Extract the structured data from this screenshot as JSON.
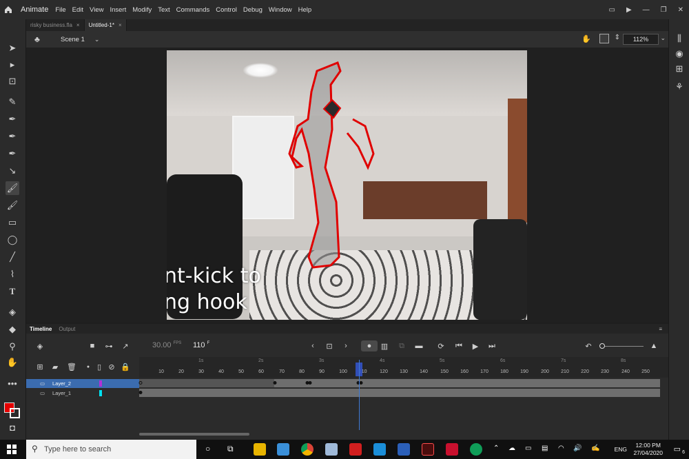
{
  "app": {
    "name": "Animate",
    "menu": [
      "File",
      "Edit",
      "View",
      "Insert",
      "Modify",
      "Text",
      "Commands",
      "Control",
      "Debug",
      "Window",
      "Help"
    ]
  },
  "tabs": [
    {
      "label": "risky business.fla",
      "active": false
    },
    {
      "label": "Untitled-1*",
      "active": true
    }
  ],
  "scene": {
    "label": "Scene 1"
  },
  "zoom": {
    "value": "112%"
  },
  "stage": {
    "caption_line1": "nt-kick to",
    "caption_line2": "ng hook"
  },
  "timeline": {
    "tab_timeline": "Timeline",
    "tab_output": "Output",
    "fps_value": "30.00",
    "fps_unit": "FPS",
    "current_frame": "110",
    "frame_unit": "F",
    "seconds": [
      "1s",
      "2s",
      "3s",
      "4s",
      "5s",
      "6s",
      "7s",
      "8s"
    ],
    "frame_ticks": [
      "10",
      "20",
      "30",
      "40",
      "50",
      "60",
      "70",
      "80",
      "90",
      "100",
      "110",
      "120",
      "130",
      "140",
      "150",
      "160",
      "170",
      "180",
      "190",
      "200",
      "210",
      "220",
      "230",
      "240",
      "250"
    ],
    "layers": [
      {
        "name": "Layer_2",
        "color": "#b030d8",
        "selected": true
      },
      {
        "name": "Layer_1",
        "color": "#00e0f0",
        "selected": false
      }
    ]
  },
  "taskbar": {
    "search_placeholder": "Type here to search",
    "language": "ENG",
    "time": "12:00 PM",
    "date": "27/04/2020",
    "notification_count": "6"
  },
  "colors": {
    "stroke": "#ffffff",
    "fill": "#e60000",
    "accent": "#3f7bd6"
  }
}
